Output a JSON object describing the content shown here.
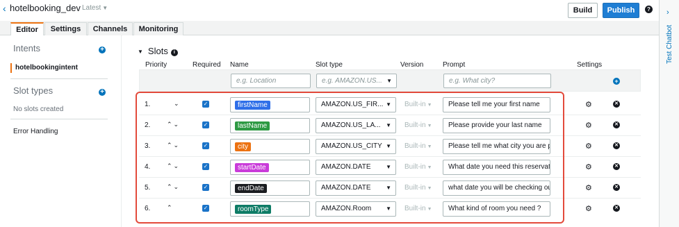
{
  "header": {
    "bot_name": "hotelbooking_dev",
    "version_selector": "Latest",
    "build_label": "Build",
    "publish_label": "Publish",
    "help_icon": "?"
  },
  "tabs": [
    {
      "label": "Editor",
      "active": true
    },
    {
      "label": "Settings",
      "active": false
    },
    {
      "label": "Channels",
      "active": false
    },
    {
      "label": "Monitoring",
      "active": false
    }
  ],
  "sidebar": {
    "intents_heading": "Intents",
    "intent_item": "hotelbookingintent",
    "slot_types_heading": "Slot types",
    "slot_types_empty": "No slots created",
    "error_handling": "Error Handling"
  },
  "slots": {
    "title": "Slots",
    "columns": {
      "priority": "Priority",
      "required": "Required",
      "name": "Name",
      "slot_type": "Slot type",
      "version": "Version",
      "prompt": "Prompt",
      "settings": "Settings"
    },
    "new_slot": {
      "name_placeholder": "e.g. Location",
      "type_placeholder": "e.g. AMAZON.US...",
      "prompt_placeholder": "e.g. What city?"
    },
    "rows": [
      {
        "priority": "1.",
        "arrows": "⌄",
        "required": true,
        "name": "firstName",
        "chip_color": "#2f6fe8",
        "slot_type": "AMAZON.US_FIR...",
        "version": "Built-in",
        "prompt": "Please tell me your first name"
      },
      {
        "priority": "2.",
        "arrows": "⌃⌄",
        "required": true,
        "name": "lastName",
        "chip_color": "#2e9a44",
        "slot_type": "AMAZON.US_LA...",
        "version": "Built-in",
        "prompt": "Please provide your last name"
      },
      {
        "priority": "3.",
        "arrows": "⌃⌄",
        "required": true,
        "name": "city",
        "chip_color": "#ec7211",
        "slot_type": "AMAZON.US_CITY",
        "version": "Built-in",
        "prompt": "Please tell me what city you are pla"
      },
      {
        "priority": "4.",
        "arrows": "⌃⌄",
        "required": true,
        "name": "startDate",
        "chip_color": "#c93bd9",
        "slot_type": "AMAZON.DATE",
        "version": "Built-in",
        "prompt": "What date you need this reservatio"
      },
      {
        "priority": "5.",
        "arrows": "⌃⌄",
        "required": true,
        "name": "endDate",
        "chip_color": "#1b1d21",
        "slot_type": "AMAZON.DATE",
        "version": "Built-in",
        "prompt": "what date you will be checking out"
      },
      {
        "priority": "6.",
        "arrows": "⌃",
        "required": true,
        "name": "roomType",
        "chip_color": "#0e7c66",
        "slot_type": "AMAZON.Room",
        "version": "Built-in",
        "prompt": "What kind of room you need ?"
      }
    ]
  },
  "chatbot_rail": {
    "label": "Test Chatbot"
  },
  "icons": {
    "back": "chevron-left-icon",
    "help": "help-icon",
    "info": "info-icon",
    "add": "plus-circle-icon",
    "settings": "gear-icon",
    "remove": "remove-circle-icon",
    "check": "checkbox-checked-icon"
  },
  "colors": {
    "accent_orange": "#ec7211",
    "primary_blue": "#1f7ed4",
    "highlight_red": "#e34a3b"
  }
}
